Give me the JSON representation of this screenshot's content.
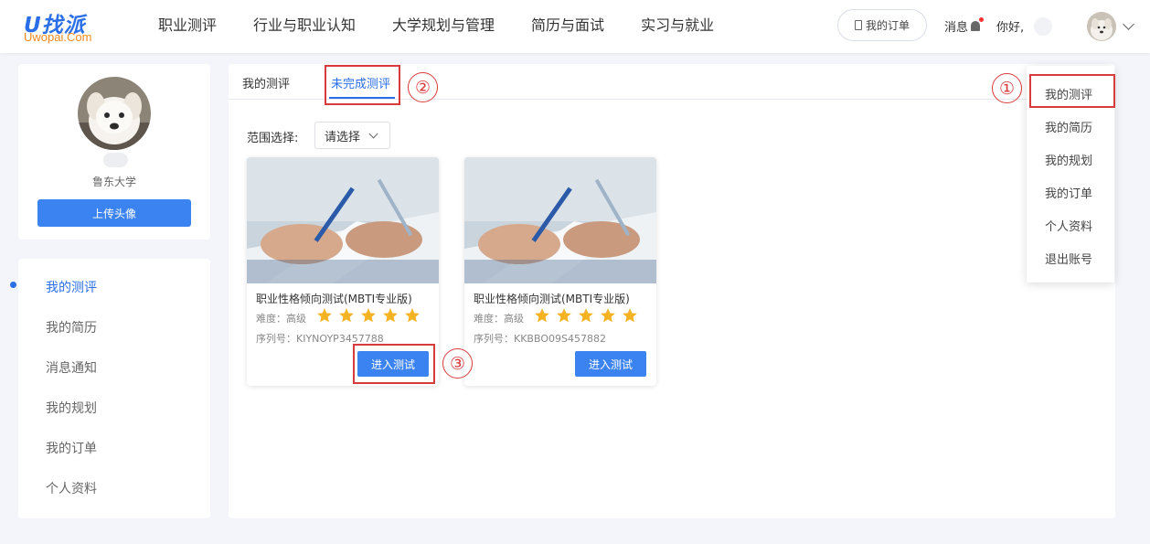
{
  "header": {
    "logo_text": "U找派",
    "logo_sub": "Uwopai.Com",
    "nav": [
      "职业测评",
      "行业与职业认知",
      "大学规划与管理",
      "简历与面试",
      "实习与就业"
    ],
    "order_button": "我的订单",
    "messages_label": "消息",
    "greeting": "你好,"
  },
  "profile": {
    "school": "鲁东大学",
    "upload_button": "上传头像"
  },
  "sidebar": {
    "items": [
      {
        "label": "我的测评",
        "active": true
      },
      {
        "label": "我的简历"
      },
      {
        "label": "消息通知"
      },
      {
        "label": "我的规划"
      },
      {
        "label": "我的订单"
      },
      {
        "label": "个人资料"
      }
    ]
  },
  "main": {
    "tabs": [
      {
        "label": "我的测评"
      },
      {
        "label": "未完成测评",
        "active": true
      }
    ],
    "range_label": "范围选择:",
    "range_select": "请选择",
    "cards": [
      {
        "title": "职业性格倾向测试(MBTI专业版)",
        "difficulty": "难度：高级",
        "stars": 5,
        "serial": "序列号：KIYNOYP3457788",
        "button": "进入测试"
      },
      {
        "title": "职业性格倾向测试(MBTI专业版)",
        "difficulty": "难度：高级",
        "stars": 5,
        "serial": "序列号：KKBBO09S457882",
        "button": "进入测试"
      }
    ]
  },
  "dropdown": {
    "items": [
      "我的测评",
      "我的简历",
      "我的规划",
      "我的订单",
      "个人资料",
      "退出账号"
    ]
  },
  "annotations": {
    "markers": [
      "①",
      "②",
      "③"
    ]
  },
  "colors": {
    "primary": "#3c83f2",
    "accent_blue": "#2a6fe8",
    "star": "#f5b324",
    "annotation_red": "#d83b3b"
  }
}
